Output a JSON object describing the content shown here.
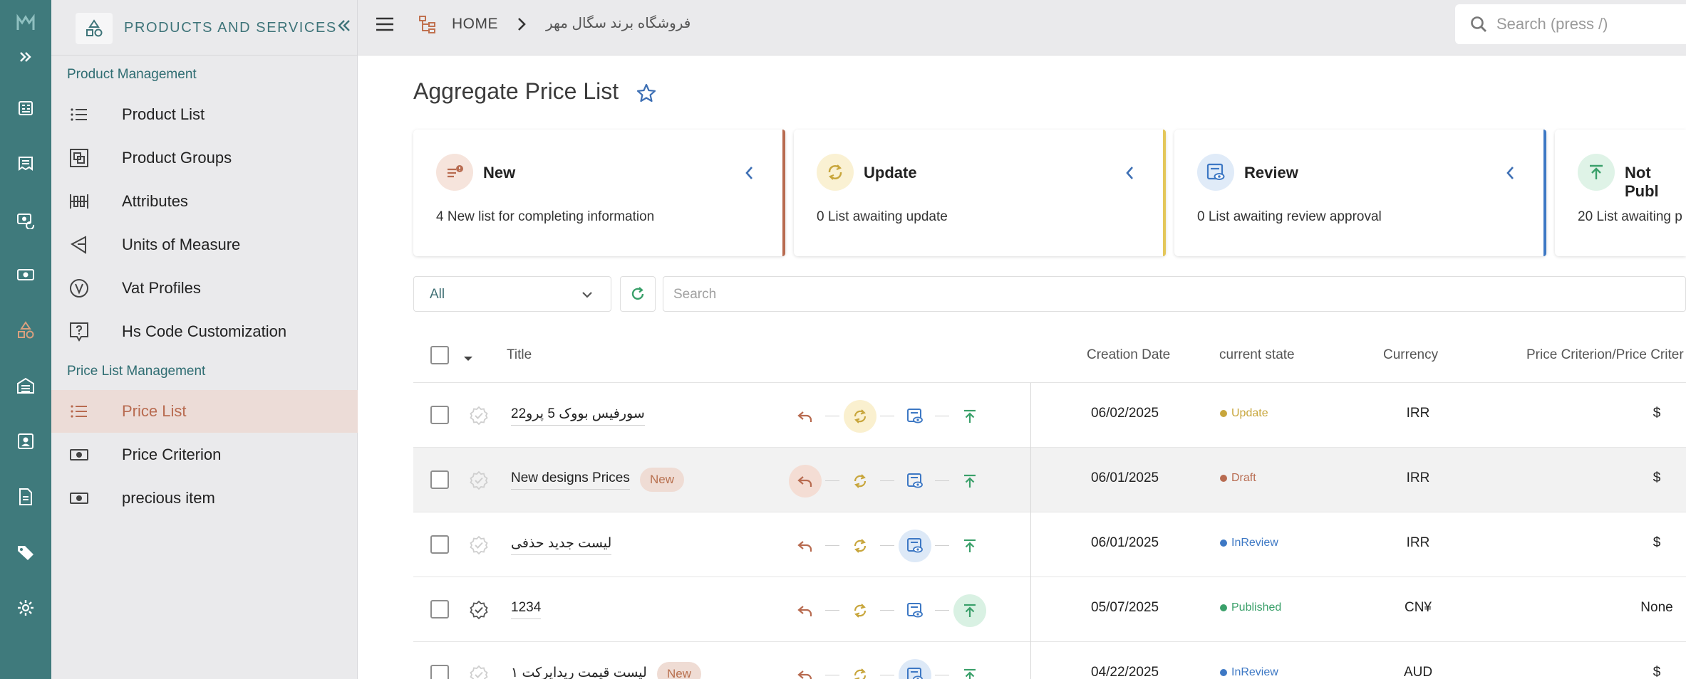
{
  "colors": {
    "rail": "#3f7a7c",
    "accent": "#3e7479",
    "orange": "#b86b50",
    "yellow": "#c8a63c",
    "blue": "#3d78c4",
    "green": "#3aa06a"
  },
  "rail_icons": [
    "dashboard-icon",
    "invoice-icon",
    "money-sync-icon",
    "cash-icon",
    "shapes-icon",
    "warehouse-icon",
    "contact-card-icon",
    "document-icon",
    "tags-icon",
    "settings-icon"
  ],
  "sidebar": {
    "title": "PRODUCTS AND SERVICES",
    "sections": [
      {
        "label": "Product Management",
        "items": [
          {
            "label": "Product List",
            "icon": "list-icon"
          },
          {
            "label": "Product Groups",
            "icon": "groups-icon"
          },
          {
            "label": "Attributes",
            "icon": "attributes-icon"
          },
          {
            "label": "Units of Measure",
            "icon": "units-icon"
          },
          {
            "label": "Vat Profiles",
            "icon": "vat-icon"
          },
          {
            "label": "Hs Code Customization",
            "icon": "hs-code-icon"
          }
        ]
      },
      {
        "label": "Price List Management",
        "items": [
          {
            "label": "Price List",
            "icon": "list-icon",
            "active": true
          },
          {
            "label": "Price Criterion",
            "icon": "cash-icon"
          },
          {
            "label": "precious item",
            "icon": "cash-icon"
          }
        ]
      }
    ]
  },
  "topbar": {
    "home": "HOME",
    "shop": "فروشگاه برند سگال مهر",
    "search_placeholder": "Search (press /)"
  },
  "page": {
    "title": "Aggregate Price List"
  },
  "cards": [
    {
      "title": "New",
      "desc": "4 New list for completing information",
      "icon": "new-list-icon",
      "color": "#b86b50"
    },
    {
      "title": "Update",
      "desc": "0 List awaiting update",
      "icon": "update-icon",
      "color": "#c8a63c"
    },
    {
      "title": "Review",
      "desc": "0 List awaiting review approval",
      "icon": "review-icon",
      "color": "#3d78c4"
    },
    {
      "title": "Not Publ",
      "desc": "20 List awaiting p",
      "icon": "publish-icon",
      "color": "#3aa06a"
    }
  ],
  "filters": {
    "status_selected": "All",
    "search_placeholder": "Search"
  },
  "table": {
    "columns": [
      "Title",
      "Creation Date",
      "current state",
      "Currency",
      "Price Criterion/Price Criter"
    ],
    "rows": [
      {
        "title": "سورفیس بووک 5 پرو22",
        "badge": "",
        "active_step": 1,
        "date": "06/02/2025",
        "state": "Update",
        "state_color": "#c8a63c",
        "currency": "IRR",
        "criterion": "$",
        "verified": false
      },
      {
        "title": "New designs Prices",
        "badge": "New",
        "active_step": 0,
        "date": "06/01/2025",
        "state": "Draft",
        "state_color": "#b86b50",
        "currency": "IRR",
        "criterion": "$",
        "verified": false
      },
      {
        "title": "لیست جدید حذفی",
        "badge": "",
        "active_step": 2,
        "date": "06/01/2025",
        "state": "InReview",
        "state_color": "#3d78c4",
        "currency": "IRR",
        "criterion": "$",
        "verified": false
      },
      {
        "title": "1234",
        "badge": "",
        "active_step": 3,
        "date": "05/07/2025",
        "state": "Published",
        "state_color": "#3aa06a",
        "currency": "CN¥",
        "criterion": "None",
        "verified": true
      },
      {
        "title": "لیست قیمت ریدایرکت ۱",
        "badge": "New",
        "active_step": 2,
        "date": "04/22/2025",
        "state": "InReview",
        "state_color": "#3d78c4",
        "currency": "AUD",
        "criterion": "$",
        "verified": false
      }
    ]
  }
}
